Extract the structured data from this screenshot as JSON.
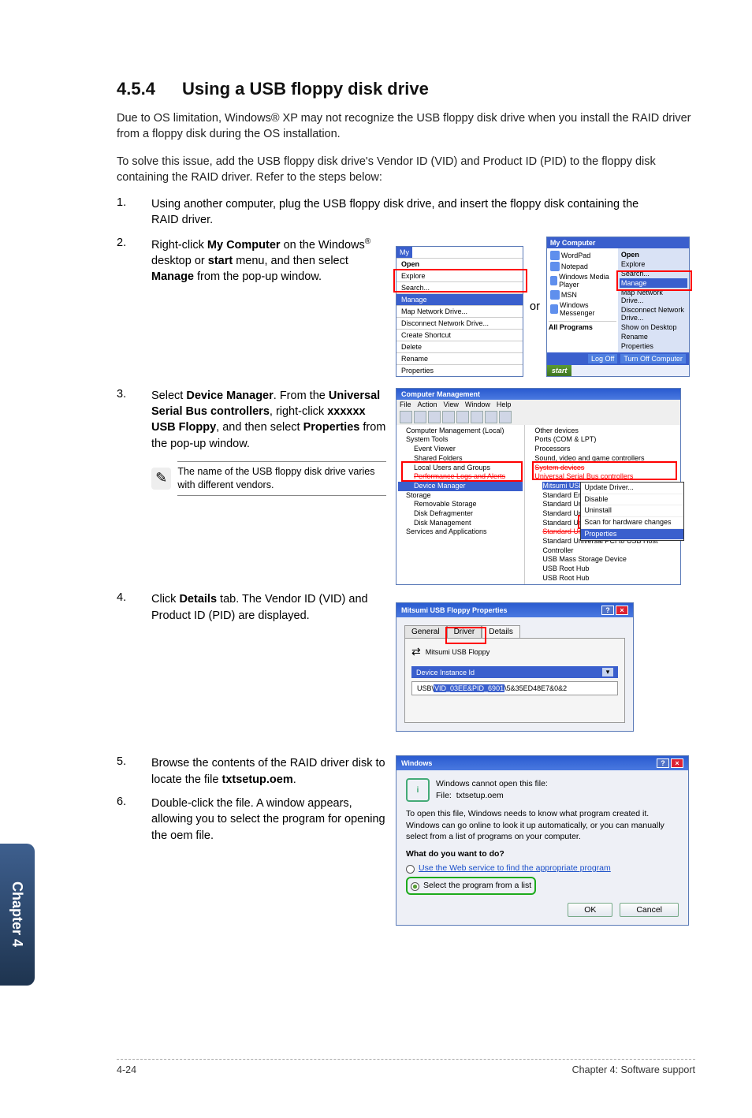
{
  "section": {
    "number": "4.5.4",
    "title": "Using a USB floppy disk drive"
  },
  "intro1": "Due to OS limitation, Windows® XP may not recognize the USB floppy disk drive when you install the RAID driver from a floppy disk during the OS installation.",
  "intro2": "To solve this issue, add the USB floppy disk drive's Vendor ID (VID) and Product ID (PID) to the floppy disk containing the RAID driver. Refer to the steps below:",
  "steps": {
    "s1": {
      "num": "1.",
      "text": "Using another computer, plug the USB floppy disk drive, and insert the floppy disk containing the RAID driver."
    },
    "s2": {
      "num": "2.",
      "p1": "Right-click ",
      "b1": "My Computer",
      "p2": " on the Windows",
      "sup": "®",
      "p3": " desktop or ",
      "b2": "start",
      "p4": " menu, and then select ",
      "b3": "Manage",
      "p5": " from the pop-up window."
    },
    "s3": {
      "num": "3.",
      "p1": "Select ",
      "b1": "Device Manager",
      "p2": ". From the ",
      "b2": "Universal Serial Bus controllers",
      "p3": ", right-click ",
      "b3": "xxxxxx USB Floppy",
      "p4": ", and then select ",
      "b4": "Properties",
      "p5": " from the pop-up window."
    },
    "s4": {
      "num": "4.",
      "p1": "Click ",
      "b1": "Details",
      "p2": " tab. The Vendor ID (VID) and Product ID (PID) are displayed."
    },
    "s5": {
      "num": "5.",
      "p1": "Browse the contents of the RAID driver disk to locate the file ",
      "b1": "txtsetup.oem",
      "p2": "."
    },
    "s6": {
      "num": "6.",
      "text": "Double-click the file. A window appears, allowing you to select the program for opening the oem file."
    }
  },
  "note": "The name of the USB floppy disk drive varies with different vendors.",
  "or": "or",
  "shot1": {
    "my": "My",
    "menu": [
      "Open",
      "Explore",
      "Search...",
      "Manage",
      "Map Network Drive...",
      "Disconnect Network Drive...",
      "Create Shortcut",
      "Delete",
      "Rename",
      "Properties"
    ],
    "start_title": "My Computer",
    "left_items": [
      "WordPad",
      "Notepad",
      "Windows Media Player",
      "MSN",
      "Windows Messenger"
    ],
    "all_programs": "All Programs",
    "right_items": [
      "Open",
      "Explore",
      "Search...",
      "Manage",
      "Map Network Drive...",
      "Disconnect Network Drive...",
      "Show on Desktop",
      "Rename",
      "Properties"
    ],
    "bottom": [
      "Log Off",
      "Turn Off Computer"
    ],
    "start": "start"
  },
  "shot2": {
    "title": "Computer Management",
    "menus": [
      "File",
      "Action",
      "View",
      "Window",
      "Help"
    ],
    "tree_root": "Computer Management (Local)",
    "tree": {
      "n0": "System Tools",
      "n1": "Event Viewer",
      "n2": "Shared Folders",
      "n3": "Local Users and Groups",
      "n3a": "Performance Logs and Alerts",
      "n4": "Device Manager",
      "n5": "Storage",
      "n6": "Removable Storage",
      "n7": "Disk Defragmenter",
      "n8": "Disk Management",
      "n9": "Services and Applications"
    },
    "right": {
      "r0": "Other devices",
      "r1": "Ports (COM & LPT)",
      "r2": "Processors",
      "r3": "Sound, video and game controllers",
      "r3a": "System devices",
      "r4": "Universal Serial Bus controllers",
      "r5": "Mitsumi USB",
      "r6": "Standard Enha",
      "r7": "Standard Unive",
      "r8": "Standard Unive",
      "r9": "Standard Un",
      "r10": "Standard Un",
      "r11": "Standard Universal PCI to USB Host Controller",
      "r12": "USB Mass Storage Device",
      "r13": "USB Root Hub",
      "r14": "USB Root Hub"
    },
    "ctx": {
      "c0": "Update Driver...",
      "c1": "Disable",
      "c2": "Uninstall",
      "c3": "Scan for hardware changes",
      "c4": "Properties"
    }
  },
  "shot3": {
    "title": "Mitsumi USB Floppy Properties",
    "tabs": {
      "t1": "General",
      "t2": "Driver",
      "t3": "Details"
    },
    "dev": "Mitsumi USB Floppy",
    "sel": "Device Instance Id",
    "value_p1": "USB\\",
    "value_hl": "VID_03EE&PID_6901",
    "value_p2": "\\5&35ED48E7&0&2"
  },
  "shot4": {
    "title": "Windows",
    "l1": "Windows cannot open this file:",
    "l2a": "File:",
    "l2b": "txtsetup.oem",
    "l3": "To open this file, Windows needs to know what program created it.  Windows can go online to look it up automatically, or you can manually select from a list of programs on your computer.",
    "q": "What do you want to do?",
    "opt1": "Use the Web service to find the appropriate program",
    "opt2": "Select the program from a list",
    "ok": "OK",
    "cancel": "Cancel"
  },
  "sidebar": "Chapter 4",
  "footer": {
    "left": "4-24",
    "right": "Chapter 4: Software support"
  }
}
